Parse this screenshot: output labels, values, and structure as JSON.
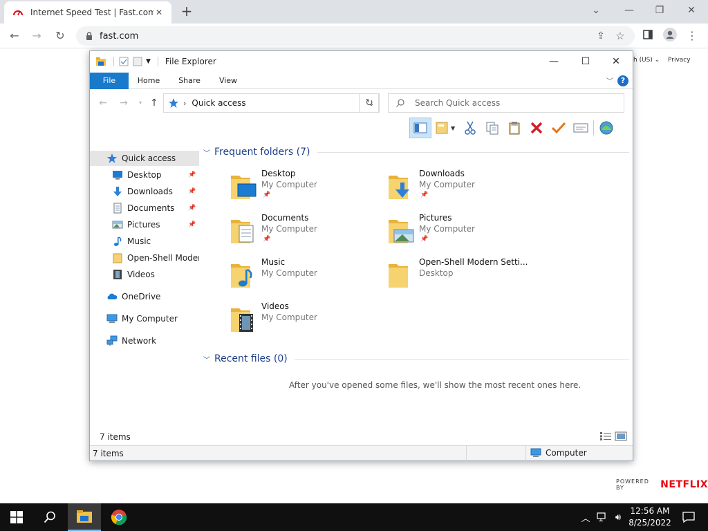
{
  "browser": {
    "tab_title": "Internet Speed Test | Fast.com",
    "url": "fast.com",
    "page_text_lang": "h (US)",
    "page_text_privacy": "Privacy",
    "powered_by": "POWERED BY",
    "brand": "NETFLIX"
  },
  "explorer": {
    "title": "File Explorer",
    "ribbon_tabs": [
      "File",
      "Home",
      "Share",
      "View"
    ],
    "address_location": "Quick access",
    "search_placeholder": "Search Quick access",
    "nav": [
      {
        "label": "Quick access",
        "icon": "star-icon",
        "pinned": false,
        "selected": true
      },
      {
        "label": "Desktop",
        "icon": "desktop-icon",
        "pinned": true
      },
      {
        "label": "Downloads",
        "icon": "download-arrow-icon",
        "pinned": true
      },
      {
        "label": "Documents",
        "icon": "documents-icon",
        "pinned": true
      },
      {
        "label": "Pictures",
        "icon": "pictures-icon",
        "pinned": true
      },
      {
        "label": "Music",
        "icon": "music-note-icon",
        "pinned": false
      },
      {
        "label": "Open-Shell Modern",
        "icon": "folder-icon",
        "pinned": false
      },
      {
        "label": "Videos",
        "icon": "videos-icon",
        "pinned": false
      },
      {
        "label": "OneDrive",
        "icon": "cloud-icon",
        "pinned": false
      },
      {
        "label": "My Computer",
        "icon": "computer-icon",
        "pinned": false
      },
      {
        "label": "Network",
        "icon": "network-icon",
        "pinned": false
      }
    ],
    "frequent_header": "Frequent folders (7)",
    "frequent": [
      {
        "name": "Desktop",
        "location": "My Computer",
        "pinned": true,
        "icon": "desktop-folder-icon"
      },
      {
        "name": "Downloads",
        "location": "My Computer",
        "pinned": true,
        "icon": "downloads-folder-icon"
      },
      {
        "name": "Documents",
        "location": "My Computer",
        "pinned": true,
        "icon": "documents-folder-icon"
      },
      {
        "name": "Pictures",
        "location": "My Computer",
        "pinned": true,
        "icon": "pictures-folder-icon"
      },
      {
        "name": "Music",
        "location": "My Computer",
        "pinned": false,
        "icon": "music-folder-icon"
      },
      {
        "name": "Open-Shell Modern Setti...",
        "location": "Desktop",
        "pinned": false,
        "icon": "folder-icon"
      },
      {
        "name": "Videos",
        "location": "My Computer",
        "pinned": false,
        "icon": "videos-folder-icon"
      }
    ],
    "recent_header": "Recent files (0)",
    "recent_message": "After you've opened some files, we'll show the most recent ones here.",
    "status_items": "7 items",
    "status_bar_items": "7 items",
    "status_bar_location": "Computer"
  },
  "taskbar": {
    "time": "12:56 AM",
    "date": "8/25/2022"
  }
}
